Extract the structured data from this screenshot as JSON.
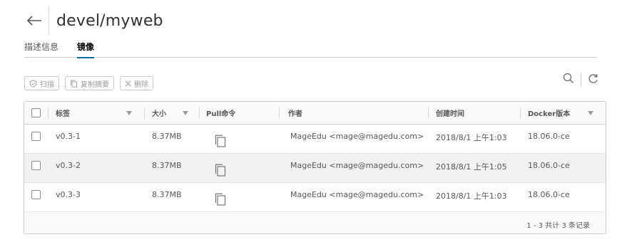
{
  "header": {
    "back_icon": "arrow-left-icon",
    "title": "devel/myweb"
  },
  "tabs": [
    {
      "label": "描述信息",
      "active": false
    },
    {
      "label": "镜像",
      "active": true
    }
  ],
  "toolbar": {
    "scan_label": "扫描",
    "copy_digest_label": "复制摘要",
    "delete_label": "删除",
    "search_icon": "search-icon",
    "refresh_icon": "refresh-icon"
  },
  "table": {
    "headers": {
      "tag": "标签",
      "size": "大小",
      "pull": "Pull命令",
      "author": "作者",
      "created": "创建时间",
      "docker": "Docker版本"
    },
    "rows": [
      {
        "tag": "v0.3-1",
        "size": "8.37MB",
        "author": "MageEdu <mage@magedu.com>",
        "created": "2018/8/1 上午1:03",
        "docker": "18.06.0-ce"
      },
      {
        "tag": "v0.3-2",
        "size": "8.37MB",
        "author": "MageEdu <mage@magedu.com>",
        "created": "2018/8/1 上午1:05",
        "docker": "18.06.0-ce"
      },
      {
        "tag": "v0.3-3",
        "size": "8.37MB",
        "author": "MageEdu <mage@magedu.com>",
        "created": "2018/8/1 上午1:03",
        "docker": "18.06.0-ce"
      }
    ],
    "footer": "1 - 3 共计 3 条记录"
  },
  "colors": {
    "accent": "#0072a3",
    "border": "#cccccc",
    "text": "#313131",
    "muted": "#9a9a9a"
  }
}
